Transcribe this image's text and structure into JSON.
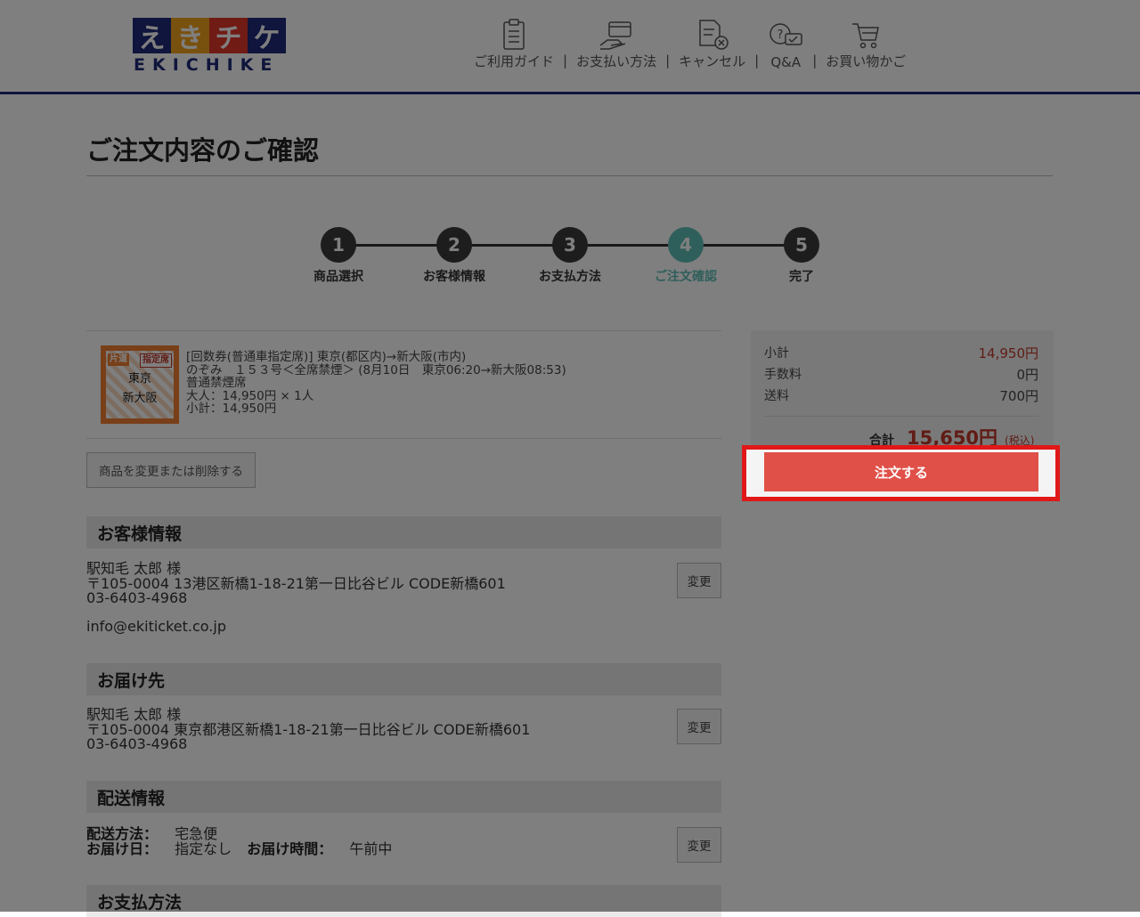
{
  "header": {
    "logo_chars": [
      "え",
      "き",
      "チ",
      "ケ"
    ],
    "logo_word": "EKICHIKE",
    "logo_colors": [
      "#1e2a78",
      "#f3a31c",
      "#e3362b",
      "#1e2a78"
    ],
    "nav": [
      {
        "label": "ご利用ガイド",
        "icon": "guide-icon"
      },
      {
        "label": "お支払い方法",
        "icon": "payment-icon"
      },
      {
        "label": "キャンセル",
        "icon": "cancel-doc-icon"
      },
      {
        "label": "Q&A",
        "icon": "qa-icon"
      },
      {
        "label": "お買い物かご",
        "icon": "cart-icon"
      }
    ],
    "separator": "|"
  },
  "page_title": "ご注文内容のご確認",
  "steps": [
    {
      "num": "1",
      "label": "商品選択"
    },
    {
      "num": "2",
      "label": "お客様情報"
    },
    {
      "num": "3",
      "label": "お支払方法"
    },
    {
      "num": "4",
      "label": "ご注文確認",
      "active": true
    },
    {
      "num": "5",
      "label": "完了"
    }
  ],
  "product": {
    "ticket": {
      "tag_left": "片道",
      "tag_right": "指定席",
      "from": "東京",
      "to": "新大阪"
    },
    "line1": "[回数券(普通車指定席)] 東京(都区内)→新大阪(市内)",
    "line2": "のぞみ　１５３号＜全席禁煙＞ (8月10日　東京06:20→新大阪08:53)",
    "line3": "普通禁煙席",
    "line4": "大人：14,950円 × 1人",
    "line5": "小計：14,950円",
    "change_button": "商品を変更または削除する"
  },
  "customer": {
    "heading": "お客様情報",
    "name": "駅知毛 太郎 様",
    "address": "〒105-0004 13港区新橋1-18-21第一日比谷ビル CODE新橋601",
    "phone": "03-6403-4968",
    "email": "info@ekiticket.co.jp",
    "change": "変更"
  },
  "delivery_to": {
    "heading": "お届け先",
    "name": "駅知毛 太郎 様",
    "address": "〒105-0004 東京都港区新橋1-18-21第一日比谷ビル CODE新橋601",
    "phone": "03-6403-4968",
    "change": "変更"
  },
  "shipping": {
    "heading": "配送情報",
    "method_label": "配送方法：",
    "method_value": "宅急便",
    "date_label": "お届け日：",
    "date_value": "指定なし",
    "time_label": "お届け時間：",
    "time_value": "午前中",
    "change": "変更"
  },
  "payment": {
    "heading": "お支払方法"
  },
  "summary": {
    "subtotal_label": "小計",
    "subtotal_value": "14,950円",
    "fee_label": "手数料",
    "fee_value": "0円",
    "shipping_label": "送料",
    "shipping_value": "700円",
    "total_label": "合計",
    "total_value": "15,650円",
    "tax_note": "(税込)",
    "order_button": "注文する",
    "price_color": "#c0392b",
    "button_color": "#e05048",
    "highlight_color": "#e01818"
  },
  "colors": {
    "brand_navy": "#1e2a78",
    "step_active": "#5fbfb6",
    "step_default": "#3a3a3a"
  }
}
